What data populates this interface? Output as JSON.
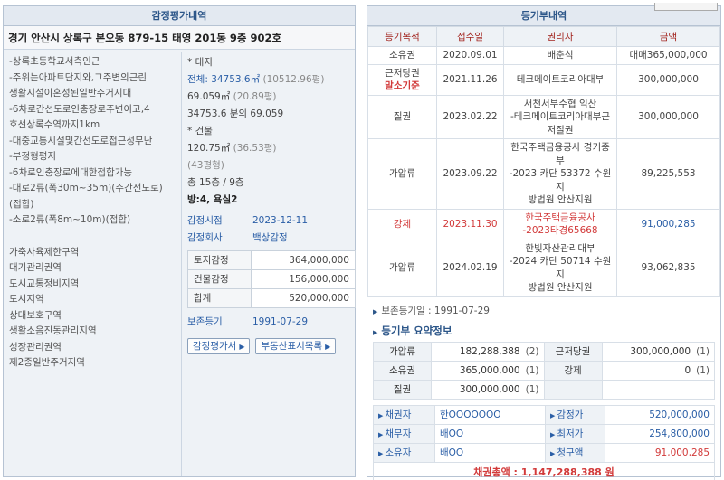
{
  "appraisal": {
    "title": "감정평가내역",
    "address": "경기 안산시 상록구 본오동 879-15 태영 201동 9층 902호",
    "notes": [
      "-상록초등학교서측인근",
      "-주위는아파트단지와,그주변의근린",
      "생활시설이혼성된일반주거지대",
      "-6차로간선도로인충장로주변이고,4",
      "호선상록수역까지1km",
      "-대중교통시설및간선도로접근성무난",
      "-부정형평지",
      "-6차로인충장로에대한접합가능",
      "-대로2류(폭30m~35m)(주간선도로)",
      "(접합)",
      "-소로2류(폭8m~10m)(접합)"
    ],
    "zones": [
      "가축사육제한구역",
      "대기관리권역",
      "도시교통정비지역",
      "도시지역",
      "상대보호구역",
      "생활소음진동관리지역",
      "성장관리권역",
      "제2종일반주거지역"
    ],
    "land_label": "* 대지",
    "land_total_label": "전체: 34753.6㎡",
    "land_total_pyeong": "(10512.96평)",
    "land_share_area": "69.059㎡",
    "land_share_pyeong": "(20.89평)",
    "land_share_ratio": "34753.6 분의 69.059",
    "building_label": "* 건물",
    "building_area": "120.75㎡",
    "building_area_pyeong": "(36.53평)",
    "building_pyeong2": "(43평형)",
    "floors": "총 15층 / 9층",
    "rooms": "방:4, 욕실2",
    "appraisal_date_label": "감정시점",
    "appraisal_date": "2023-12-11",
    "appraiser_label": "감정회사",
    "appraiser": "백상감정",
    "prices": [
      {
        "label": "토지감정",
        "value": "364,000,000"
      },
      {
        "label": "건물감정",
        "value": "156,000,000"
      },
      {
        "label": "합계",
        "value": "520,000,000"
      }
    ],
    "preservation_label": "보존등기",
    "preservation_date": "1991-07-29",
    "btn_appraisal": "감정평가서",
    "btn_realestate": "부동산표시목록"
  },
  "registry": {
    "title": "등기부내역",
    "headers": [
      "등기목적",
      "접수일",
      "권리자",
      "금액"
    ],
    "rows": [
      {
        "purpose": "소유권",
        "purpose2": "",
        "date": "2020.09.01",
        "holder": "배춘식",
        "amount": "매매365,000,000",
        "style": ""
      },
      {
        "purpose": "근저당권",
        "purpose2": "말소기준",
        "date": "2021.11.26",
        "holder": "테크메이트코리아대부",
        "amount": "300,000,000",
        "style": ""
      },
      {
        "purpose": "질권",
        "purpose2": "",
        "date": "2023.02.22",
        "holder": "서천서부수협 익산\n-테크메이트코리아대부근\n저질권",
        "amount": "300,000,000",
        "style": ""
      },
      {
        "purpose": "가압류",
        "purpose2": "",
        "date": "2023.09.22",
        "holder": "한국주택금융공사 경기중\n부\n-2023 카단 53372 수원지\n방법원 안산지원",
        "amount": "89,225,553",
        "style": ""
      },
      {
        "purpose": "강제",
        "purpose2": "",
        "date": "2023.11.30",
        "holder": "한국주택금융공사\n-2023타경65668",
        "amount": "91,000,285",
        "style": "red"
      },
      {
        "purpose": "가압류",
        "purpose2": "",
        "date": "2024.02.19",
        "holder": "한빛자산관리대부\n-2024 카단 50714 수원지\n방법원 안산지원",
        "amount": "93,062,835",
        "style": ""
      }
    ],
    "preservation_line": "보존등기일 : 1991-07-29",
    "summary_title": "등기부 요약정보",
    "summary": [
      {
        "k1": "가압류",
        "v1": "182,288,388",
        "n1": "(2)",
        "k2": "근저당권",
        "v2": "300,000,000",
        "n2": "(1)"
      },
      {
        "k1": "소유권",
        "v1": "365,000,000",
        "n1": "(1)",
        "k2": "강제",
        "v2": "0",
        "n2": "(1)"
      },
      {
        "k1": "질권",
        "v1": "300,000,000",
        "n1": "(1)",
        "k2": "",
        "v2": "",
        "n2": ""
      }
    ],
    "parties": [
      {
        "k1": "채권자",
        "v1": "한OOOOOOO",
        "k2": "감정가",
        "v2": "520,000,000",
        "red": false
      },
      {
        "k1": "채무자",
        "v1": "배OO",
        "k2": "최저가",
        "v2": "254,800,000",
        "red": false
      },
      {
        "k1": "소유자",
        "v1": "배OO",
        "k2": "청구액",
        "v2": "91,000,285",
        "red": true
      }
    ],
    "total": "채권총액 : 1,147,288,388 원"
  },
  "colors": {
    "accent": "#2c5689",
    "red": "#d23a3a",
    "header_bg": "#e3e9f1"
  }
}
